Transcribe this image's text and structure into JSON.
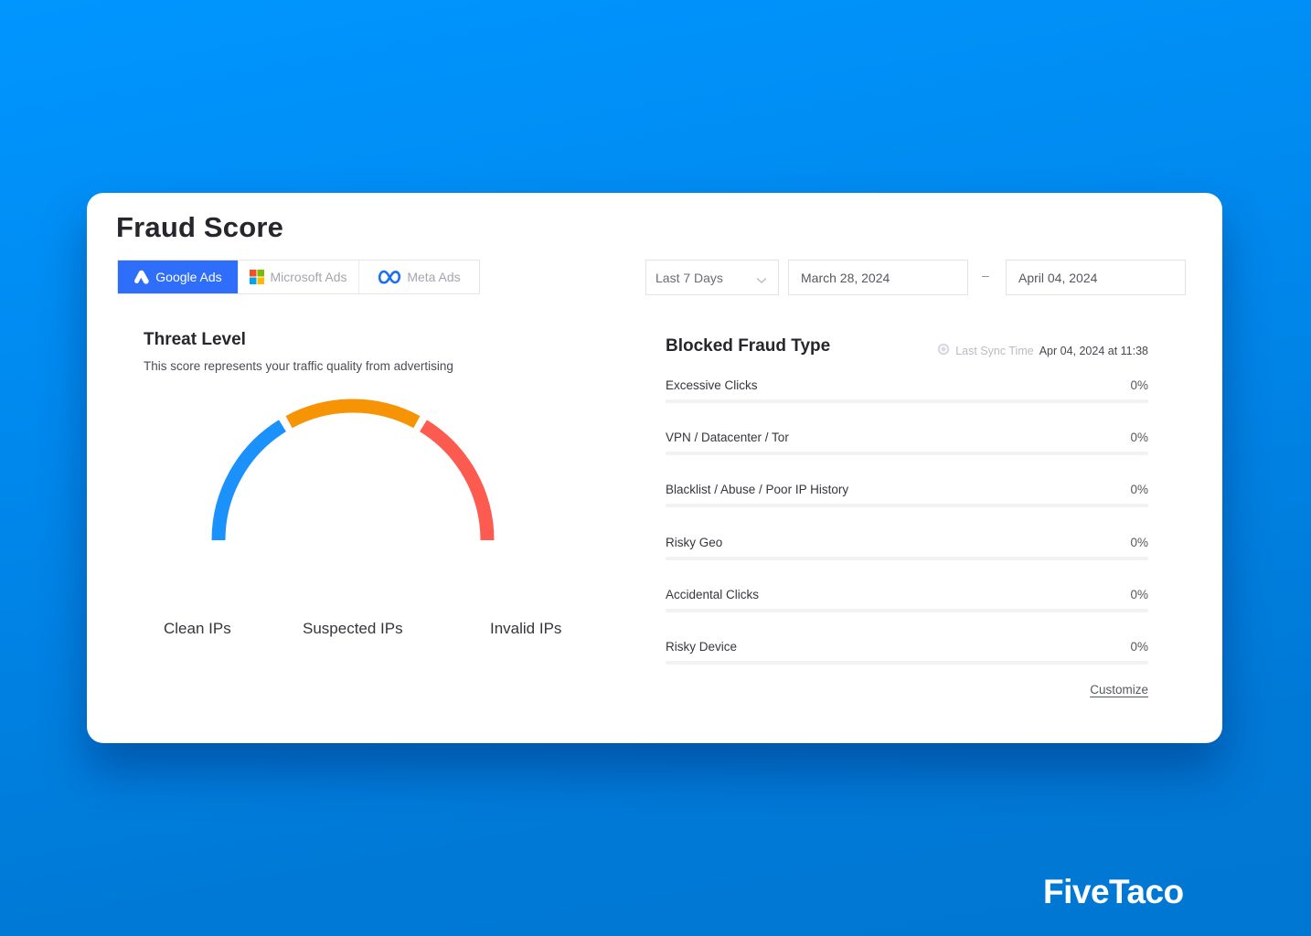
{
  "page": {
    "title": "Fraud Score",
    "brand": "FiveTaco"
  },
  "platform_tabs": [
    {
      "label": "Google Ads",
      "icon": "google-ads-icon",
      "active": true
    },
    {
      "label": "Microsoft Ads",
      "icon": "microsoft-icon",
      "active": false
    },
    {
      "label": "Meta Ads",
      "icon": "meta-icon",
      "active": false
    }
  ],
  "date_filter": {
    "range_selected": "Last 7 Days",
    "from": "March 28, 2024",
    "separator": "–",
    "to": "April 04, 2024"
  },
  "threat_level": {
    "title": "Threat Level",
    "subtitle": "This score represents your traffic quality from advertising",
    "segments": [
      {
        "label": "Clean IPs",
        "color": "#1a91fb"
      },
      {
        "label": "Suspected IPs",
        "color": "#f79406"
      },
      {
        "label": "Invalid IPs",
        "color": "#fd5b4f"
      }
    ]
  },
  "blocked_fraud": {
    "title": "Blocked Fraud Type",
    "sync_label": "Last Sync Time",
    "sync_value": "Apr 04, 2024 at 11:38",
    "items": [
      {
        "label": "Excessive Clicks",
        "value": "0%",
        "percent": 0
      },
      {
        "label": "VPN / Datacenter / Tor",
        "value": "0%",
        "percent": 0
      },
      {
        "label": "Blacklist / Abuse / Poor IP History",
        "value": "0%",
        "percent": 0
      },
      {
        "label": "Risky Geo",
        "value": "0%",
        "percent": 0
      },
      {
        "label": "Accidental Clicks",
        "value": "0%",
        "percent": 0
      },
      {
        "label": "Risky Device",
        "value": "0%",
        "percent": 0
      }
    ],
    "customize_label": "Customize"
  },
  "colors": {
    "accent": "#2f6dfb",
    "clean": "#1a91fb",
    "suspected": "#f79406",
    "invalid": "#fd5b4f"
  }
}
